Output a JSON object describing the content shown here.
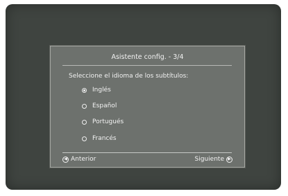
{
  "dialog": {
    "title": "Asistente config. - 3/4",
    "prompt": "Seleccione el idioma de los subtítulos:",
    "options": [
      {
        "label": "Inglés",
        "selected": true
      },
      {
        "label": "Español",
        "selected": false
      },
      {
        "label": "Portugués",
        "selected": false
      },
      {
        "label": "Francés",
        "selected": false
      }
    ],
    "prev_label": "Anterior",
    "next_label": "Siguiente"
  },
  "icons": {
    "prev": "arrow-left-circle-icon",
    "next": "arrow-right-circle-icon",
    "radio_selected": "radio-selected-icon",
    "radio_unselected": "radio-unselected-icon"
  }
}
